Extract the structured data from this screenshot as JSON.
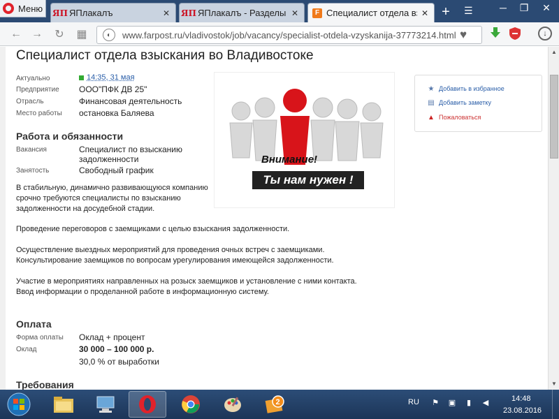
{
  "browser": {
    "menu_label": "Меню",
    "tabs": [
      {
        "title": "ЯПлакалъ",
        "favicon": "yap-icon"
      },
      {
        "title": "ЯПлакалъ - Разделы ->",
        "favicon": "yap-icon"
      },
      {
        "title": "Специалист отдела взыс",
        "favicon": "farpost-icon",
        "active": true
      }
    ],
    "url": "www.farpost.ru/vladivostok/job/vacancy/specialist-otdela-vzyskanija-37773214.html"
  },
  "page": {
    "title": "Специалист отдела взыскания во Владивостоке",
    "info": [
      {
        "label": "Актуально",
        "value": "14:35, 31 мая"
      },
      {
        "label": "Предприятие",
        "value": "ООО\"ПФК ДВ 25\""
      },
      {
        "label": "Отрасль",
        "value": "Финансовая деятельность"
      },
      {
        "label": "Место работы",
        "value": "остановка Баляева"
      }
    ],
    "duties_heading": "Работа и обязанности",
    "duties": [
      {
        "label": "Вакансия",
        "value": "Специалист по взысканию задолженности"
      },
      {
        "label": "Занятость",
        "value": "Свободный график"
      }
    ],
    "description": [
      "В стабильную, динамично развивающуюся компанию срочно требуются специалисты по взысканию задолженности на досудебной стадии.",
      "Проведение переговоров с заемщиками с целью взыскания задолженности.",
      "Осуществление выездных мероприятий для проведения очных встреч с заемщиками. Консультирование заемщиков по вопросам урегулирования имеющейся задолженности.",
      "Участие в мероприятиях направленных на розыск заемщиков и установление с ними контакта. Ввод информации о проделанной работе в информационную систему."
    ],
    "image_caption": {
      "line1": "Внимание!",
      "line2": "Ты нам нужен !"
    },
    "pay_heading": "Оплата",
    "pay": [
      {
        "label": "Форма оплаты",
        "value": "Оклад + процент"
      },
      {
        "label": "Оклад",
        "value": "30 000 – 100 000 р."
      },
      {
        "label": "",
        "value": "30,0 % от выработки"
      }
    ],
    "requirements_heading": "Требования",
    "side_actions": [
      {
        "label": "Добавить в избранное",
        "icon": "star-icon"
      },
      {
        "label": "Добавить заметку",
        "icon": "note-icon"
      },
      {
        "label": "Пожаловаться",
        "icon": "warning-icon"
      }
    ]
  },
  "taskbar": {
    "apps": [
      "file-explorer-icon",
      "computer-icon",
      "opera-icon",
      "chrome-icon",
      "paint-icon",
      "game-icon"
    ],
    "lang": "RU",
    "time": "14:48",
    "date": "23.08.2016"
  },
  "colors": {
    "accent": "#2a5ea8",
    "taskbar": "#1c3558",
    "opera_red": "#e0222b",
    "farpost_orange": "#f07a1a"
  }
}
